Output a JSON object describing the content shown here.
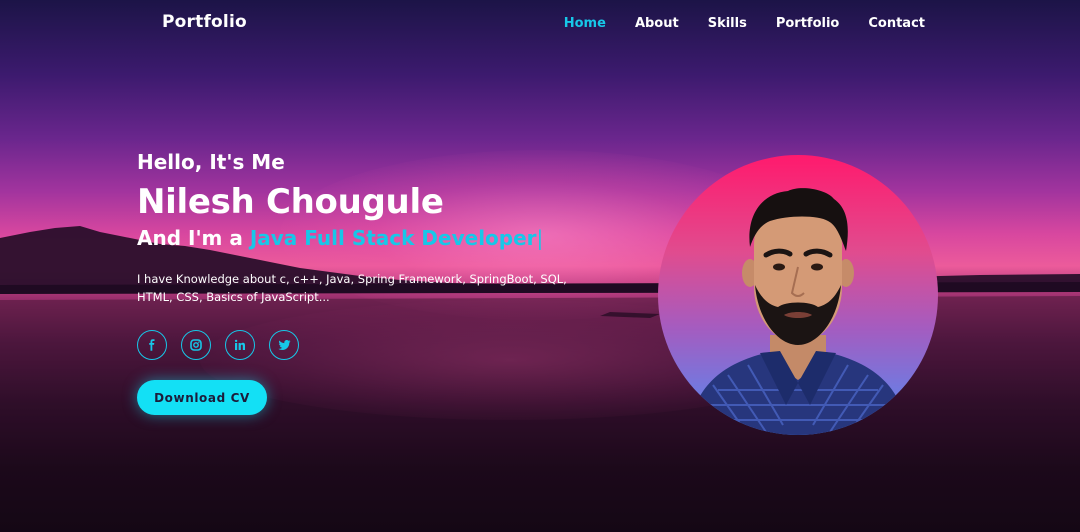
{
  "nav": {
    "logo": "Portfolio",
    "links": [
      {
        "label": "Home",
        "active": true
      },
      {
        "label": "About",
        "active": false
      },
      {
        "label": "Skills",
        "active": false
      },
      {
        "label": "Portfolio",
        "active": false
      },
      {
        "label": "Contact",
        "active": false
      }
    ]
  },
  "hero": {
    "greeting": "Hello, It's Me",
    "name": "Nilesh Chougule",
    "role_prefix": "And I'm a ",
    "role_highlight": "Java Full Stack Developer",
    "cursor": "|",
    "description": "I have Knowledge about c, c++, Java, Spring Framework, SpringBoot, SQL, HTML, CSS, Basics of JavaScript...",
    "socials": [
      {
        "icon": "facebook-icon"
      },
      {
        "icon": "instagram-icon"
      },
      {
        "icon": "linkedin-icon"
      },
      {
        "icon": "twitter-icon"
      }
    ],
    "cta_label": "Download CV"
  },
  "colors": {
    "accent": "#17c7e8",
    "button": "#13e0f5"
  }
}
